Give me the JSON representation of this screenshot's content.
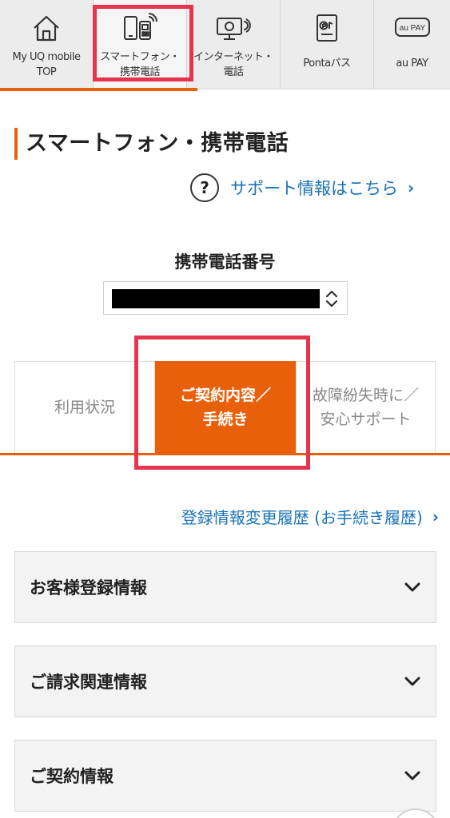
{
  "nav": {
    "items": [
      {
        "label": "My UQ mobile\nTOP",
        "icon": "home-icon"
      },
      {
        "label": "スマートフォン・\n携帯電話",
        "icon": "smartphone-icon"
      },
      {
        "label": "インターネット・\n電話",
        "icon": "internet-icon"
      },
      {
        "label": "Pontaパス",
        "icon": "ponta-icon"
      },
      {
        "label": "au PAY",
        "icon": "au-pay-icon",
        "icon_text": "au PAY"
      }
    ],
    "active_index": 1,
    "accent_color": "#e8600a",
    "highlight_color": "#e6344f"
  },
  "page": {
    "title": "スマートフォン・携帯電話",
    "support_link": "サポート情報はこちら",
    "help_icon_text": "?"
  },
  "phone": {
    "label": "携帯電話番号",
    "selected_value_redacted": true
  },
  "tabs": [
    {
      "label": "利用状況",
      "active": false
    },
    {
      "label": "ご契約内容／\n手続き",
      "active": true
    },
    {
      "label": "故障紛失時に／\n安心サポート",
      "active": false
    }
  ],
  "history_link": "登録情報変更履歴 (お手続き履歴)",
  "accordions": [
    {
      "label": "お客様登録情報"
    },
    {
      "label": "ご請求関連情報"
    },
    {
      "label": "ご契約情報"
    }
  ],
  "colors": {
    "link": "#1a73b8",
    "accent": "#e8600a"
  }
}
